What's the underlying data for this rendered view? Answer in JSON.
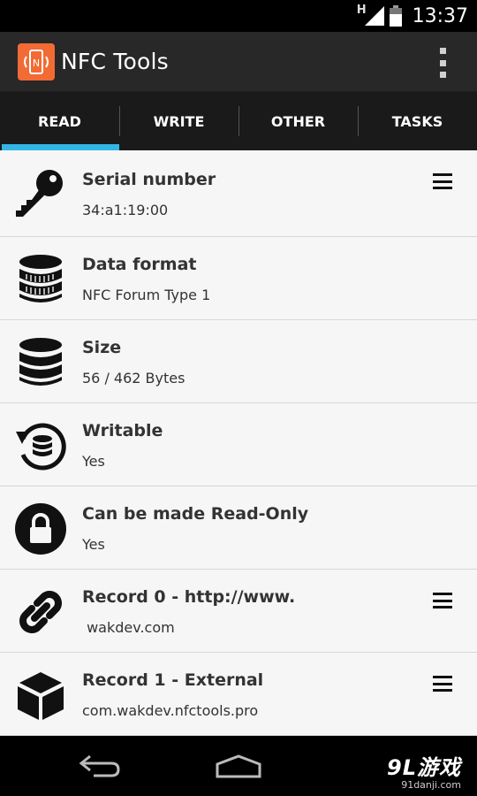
{
  "status_bar": {
    "network": "H",
    "time": "13:37"
  },
  "app": {
    "title": "NFC Tools",
    "icon_letter": "N",
    "icon_color": "#f26b34"
  },
  "tabs": [
    {
      "label": "READ",
      "active": true
    },
    {
      "label": "WRITE",
      "active": false
    },
    {
      "label": "OTHER",
      "active": false
    },
    {
      "label": "TASKS",
      "active": false
    }
  ],
  "accent_color": "#33b5e5",
  "rows": [
    {
      "icon": "key-icon",
      "title": "Serial number",
      "value": "34:a1:19:00",
      "menu": true
    },
    {
      "icon": "database-striped-icon",
      "title": "Data format",
      "value": "NFC Forum Type 1",
      "menu": false
    },
    {
      "icon": "database-icon",
      "title": "Size",
      "value": "56 / 462 Bytes",
      "menu": false
    },
    {
      "icon": "rewrite-icon",
      "title": "Writable",
      "value": "Yes",
      "menu": false
    },
    {
      "icon": "lock-icon",
      "title": "Can be made Read-Only",
      "value": "Yes",
      "menu": false
    },
    {
      "icon": "link-icon",
      "title": "Record 0 - http://www.",
      "value": " wakdev.com",
      "menu": true
    },
    {
      "icon": "cube-icon",
      "title": "Record 1 - External",
      "value": "com.wakdev.nfctools.pro",
      "menu": true
    }
  ],
  "watermark": {
    "main": "9L游戏",
    "sub": "91danji.com"
  }
}
